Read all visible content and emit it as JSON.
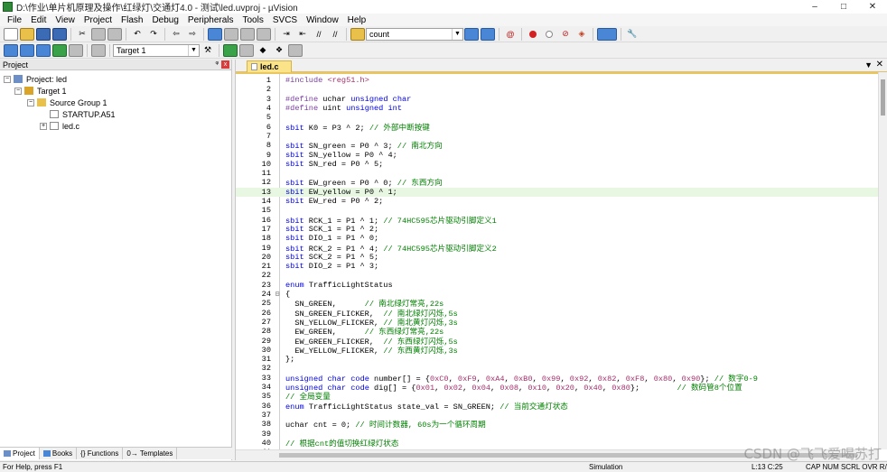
{
  "window": {
    "title": "D:\\作业\\单片机原理及操作\\红绿灯\\交通灯4.0 - 测试\\led.uvproj - µVision",
    "minimize": "–",
    "maximize": "□",
    "close": "✕"
  },
  "menu": [
    "File",
    "Edit",
    "View",
    "Project",
    "Flash",
    "Debug",
    "Peripherals",
    "Tools",
    "SVCS",
    "Window",
    "Help"
  ],
  "toolbar": {
    "find_combo_value": "count",
    "target_combo_value": "Target 1"
  },
  "project_panel": {
    "title": "Project",
    "pin": "ᵠ",
    "close": "x",
    "tree": [
      {
        "label": "Project: led",
        "level": 0,
        "expanded": true,
        "icon": "project-icon"
      },
      {
        "label": "Target 1",
        "level": 1,
        "expanded": true,
        "icon": "target-icon"
      },
      {
        "label": "Source Group 1",
        "level": 2,
        "expanded": true,
        "icon": "folder-icon"
      },
      {
        "label": "STARTUP.A51",
        "level": 3,
        "expanded": null,
        "icon": "file-icon"
      },
      {
        "label": "led.c",
        "level": 3,
        "expanded": false,
        "icon": "file-icon"
      }
    ],
    "tabs": [
      "Project",
      "Books",
      "{} Functions",
      "0→ Templates"
    ]
  },
  "editor": {
    "tab_label": "led.c",
    "highlighted_line": 13,
    "lines": [
      "#include <reg51.h>",
      "",
      "#define uchar unsigned char",
      "#define uint unsigned int",
      "",
      "sbit K0 = P3 ^ 2; // 外部中断按键",
      "",
      "sbit SN_green = P0 ^ 3; // 南北方向",
      "sbit SN_yellow = P0 ^ 4;",
      "sbit SN_red = P0 ^ 5;",
      "",
      "sbit EW_green = P0 ^ 0; // 东西方向",
      "sbit EW_yellow = P0 ^ 1;",
      "sbit EW_red = P0 ^ 2;",
      "",
      "sbit RCK_1 = P1 ^ 1; // 74HC595芯片驱动引脚定义1",
      "sbit SCK_1 = P1 ^ 2;",
      "sbit DIO_1 = P1 ^ 0;",
      "sbit RCK_2 = P1 ^ 4; // 74HC595芯片驱动引脚定义2",
      "sbit SCK_2 = P1 ^ 5;",
      "sbit DIO_2 = P1 ^ 3;",
      "",
      "enum TrafficLightStatus",
      "{",
      "  SN_GREEN,      // 南北绿灯常亮,22s",
      "  SN_GREEN_FLICKER,  // 南北绿灯闪烁,5s",
      "  SN_YELLOW_FLICKER, // 南北黄灯闪烁,3s",
      "  EW_GREEN,      // 东西绿灯常亮,22s",
      "  EW_GREEN_FLICKER,  // 东西绿灯闪烁,5s",
      "  EW_YELLOW_FLICKER, // 东西黄灯闪烁,3s",
      "};",
      "",
      "unsigned char code number[] = {0xC0, 0xF9, 0xA4, 0xB0, 0x99, 0x92, 0x82, 0xF8, 0x80, 0x90}; // 数字0-9",
      "unsigned char code dig[] = {0x01, 0x02, 0x04, 0x08, 0x10, 0x20, 0x40, 0x80};        // 数码管8个位置",
      "// 全局变量",
      "enum TrafficLightStatus state_val = SN_GREEN; // 当前交通灯状态",
      "",
      "uchar cnt = 0; // 时间计数器, 60s为一个循环周期",
      "",
      "// 根据cnt的值切换红绿灯状态",
      ""
    ]
  },
  "statusbar": {
    "help": "For Help, press F1",
    "mode": "Simulation",
    "position": "L:13 C:25",
    "keys": "CAP  NUM  SCRL  OVR  R/W"
  },
  "watermark": "CSDN @飞飞爱喝苏打"
}
